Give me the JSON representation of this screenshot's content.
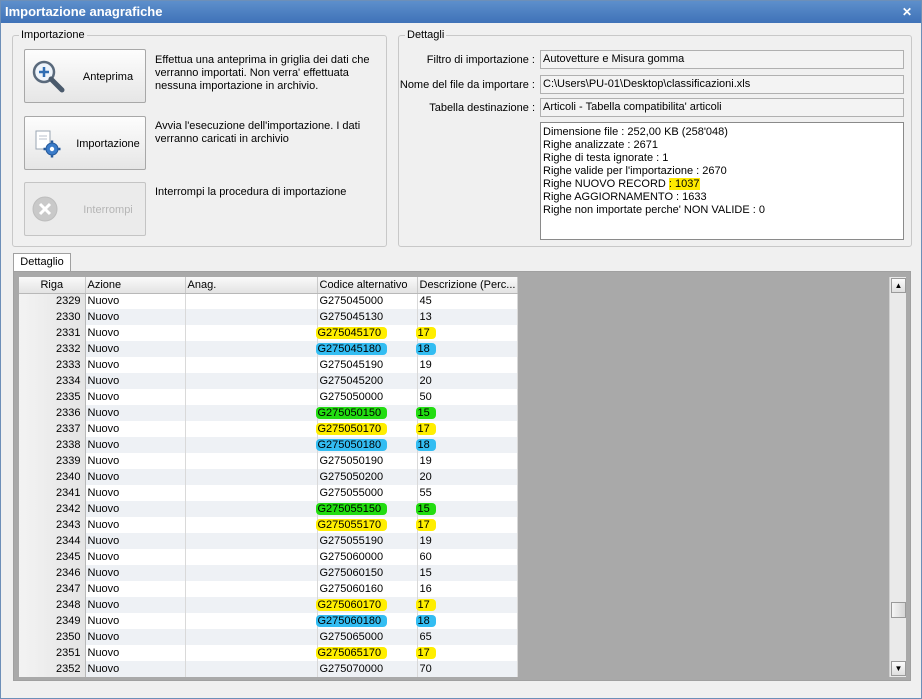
{
  "window": {
    "title": "Importazione anagrafiche"
  },
  "importazione": {
    "title": "Importazione",
    "anteprima_label": "Anteprima",
    "anteprima_desc": [
      "Effettua una anteprima in griglia dei dati che",
      "verranno importati. Non verra' effettuata",
      "nessuna importazione in archivio."
    ],
    "importazione_label": "Importazione",
    "importazione_desc": [
      "Avvia l'esecuzione dell'importazione. I dati",
      "verranno caricati in archivio"
    ],
    "interrompi_label": "Interrompi",
    "interrompi_desc": [
      "Interrompi la procedura di importazione"
    ]
  },
  "dettagli": {
    "title": "Dettagli",
    "filtro_label": "Filtro di importazione :",
    "filtro_value": "Autovetture e Misura gomma",
    "file_label": "Nome del file da importare :",
    "file_value": "C:\\Users\\PU-01\\Desktop\\classificazioni.xls",
    "tabella_label": "Tabella destinazione :",
    "tabella_value": "Articoli - Tabella compatibilita' articoli",
    "summary": {
      "dimensione": "Dimensione file : 252,00 KB (258'048)",
      "analizzate": "Righe analizzate : 2671",
      "ignorate": "Righe di testa ignorate : 1",
      "valide": "Righe valide per l'importazione : 2670",
      "nuovo_label": "Righe NUOVO RECORD ",
      "nuovo_value": ": 1037",
      "aggiornamento": "Righe AGGIORNAMENTO  : 1633",
      "non_valide": "Righe non importate perche' NON VALIDE : 0"
    }
  },
  "tab": {
    "dettaglio": "Dettaglio"
  },
  "grid": {
    "columns": [
      "Riga",
      "Azione",
      "Anag.",
      "Codice alternativo",
      "Descrizione (Perc..."
    ],
    "rows": [
      {
        "riga": "2329",
        "azione": "Nuovo",
        "anag": "",
        "codice": "G275045000",
        "desc": "45",
        "mark": ""
      },
      {
        "riga": "2330",
        "azione": "Nuovo",
        "anag": "",
        "codice": "G275045130",
        "desc": "13",
        "mark": ""
      },
      {
        "riga": "2331",
        "azione": "Nuovo",
        "anag": "",
        "codice": "G275045170",
        "desc": "17",
        "mark": "yellow"
      },
      {
        "riga": "2332",
        "azione": "Nuovo",
        "anag": "",
        "codice": "G275045180",
        "desc": "18",
        "mark": "blue"
      },
      {
        "riga": "2333",
        "azione": "Nuovo",
        "anag": "",
        "codice": "G275045190",
        "desc": "19",
        "mark": ""
      },
      {
        "riga": "2334",
        "azione": "Nuovo",
        "anag": "",
        "codice": "G275045200",
        "desc": "20",
        "mark": ""
      },
      {
        "riga": "2335",
        "azione": "Nuovo",
        "anag": "",
        "codice": "G275050000",
        "desc": "50",
        "mark": ""
      },
      {
        "riga": "2336",
        "azione": "Nuovo",
        "anag": "",
        "codice": "G275050150",
        "desc": "15",
        "mark": "green"
      },
      {
        "riga": "2337",
        "azione": "Nuovo",
        "anag": "",
        "codice": "G275050170",
        "desc": "17",
        "mark": "yellow"
      },
      {
        "riga": "2338",
        "azione": "Nuovo",
        "anag": "",
        "codice": "G275050180",
        "desc": "18",
        "mark": "blue"
      },
      {
        "riga": "2339",
        "azione": "Nuovo",
        "anag": "",
        "codice": "G275050190",
        "desc": "19",
        "mark": ""
      },
      {
        "riga": "2340",
        "azione": "Nuovo",
        "anag": "",
        "codice": "G275050200",
        "desc": "20",
        "mark": ""
      },
      {
        "riga": "2341",
        "azione": "Nuovo",
        "anag": "",
        "codice": "G275055000",
        "desc": "55",
        "mark": ""
      },
      {
        "riga": "2342",
        "azione": "Nuovo",
        "anag": "",
        "codice": "G275055150",
        "desc": "15",
        "mark": "green"
      },
      {
        "riga": "2343",
        "azione": "Nuovo",
        "anag": "",
        "codice": "G275055170",
        "desc": "17",
        "mark": "yellow"
      },
      {
        "riga": "2344",
        "azione": "Nuovo",
        "anag": "",
        "codice": "G275055190",
        "desc": "19",
        "mark": ""
      },
      {
        "riga": "2345",
        "azione": "Nuovo",
        "anag": "",
        "codice": "G275060000",
        "desc": "60",
        "mark": ""
      },
      {
        "riga": "2346",
        "azione": "Nuovo",
        "anag": "",
        "codice": "G275060150",
        "desc": "15",
        "mark": ""
      },
      {
        "riga": "2347",
        "azione": "Nuovo",
        "anag": "",
        "codice": "G275060160",
        "desc": "16",
        "mark": ""
      },
      {
        "riga": "2348",
        "azione": "Nuovo",
        "anag": "",
        "codice": "G275060170",
        "desc": "17",
        "mark": "yellow"
      },
      {
        "riga": "2349",
        "azione": "Nuovo",
        "anag": "",
        "codice": "G275060180",
        "desc": "18",
        "mark": "blue"
      },
      {
        "riga": "2350",
        "azione": "Nuovo",
        "anag": "",
        "codice": "G275065000",
        "desc": "65",
        "mark": ""
      },
      {
        "riga": "2351",
        "azione": "Nuovo",
        "anag": "",
        "codice": "G275065170",
        "desc": "17",
        "mark": "yellow"
      },
      {
        "riga": "2352",
        "azione": "Nuovo",
        "anag": "",
        "codice": "G275070000",
        "desc": "70",
        "mark": ""
      }
    ]
  },
  "colors": {
    "titlebar": "#4a7fc1",
    "highlight_yellow": "#ffee00",
    "highlight_blue": "#33bdf2",
    "highlight_green": "#22dd11"
  },
  "icons": {
    "anteprima": "magnifier-plus-icon",
    "importazione": "gear-document-icon",
    "interrompi": "cancel-circle-icon",
    "close": "close-icon"
  }
}
